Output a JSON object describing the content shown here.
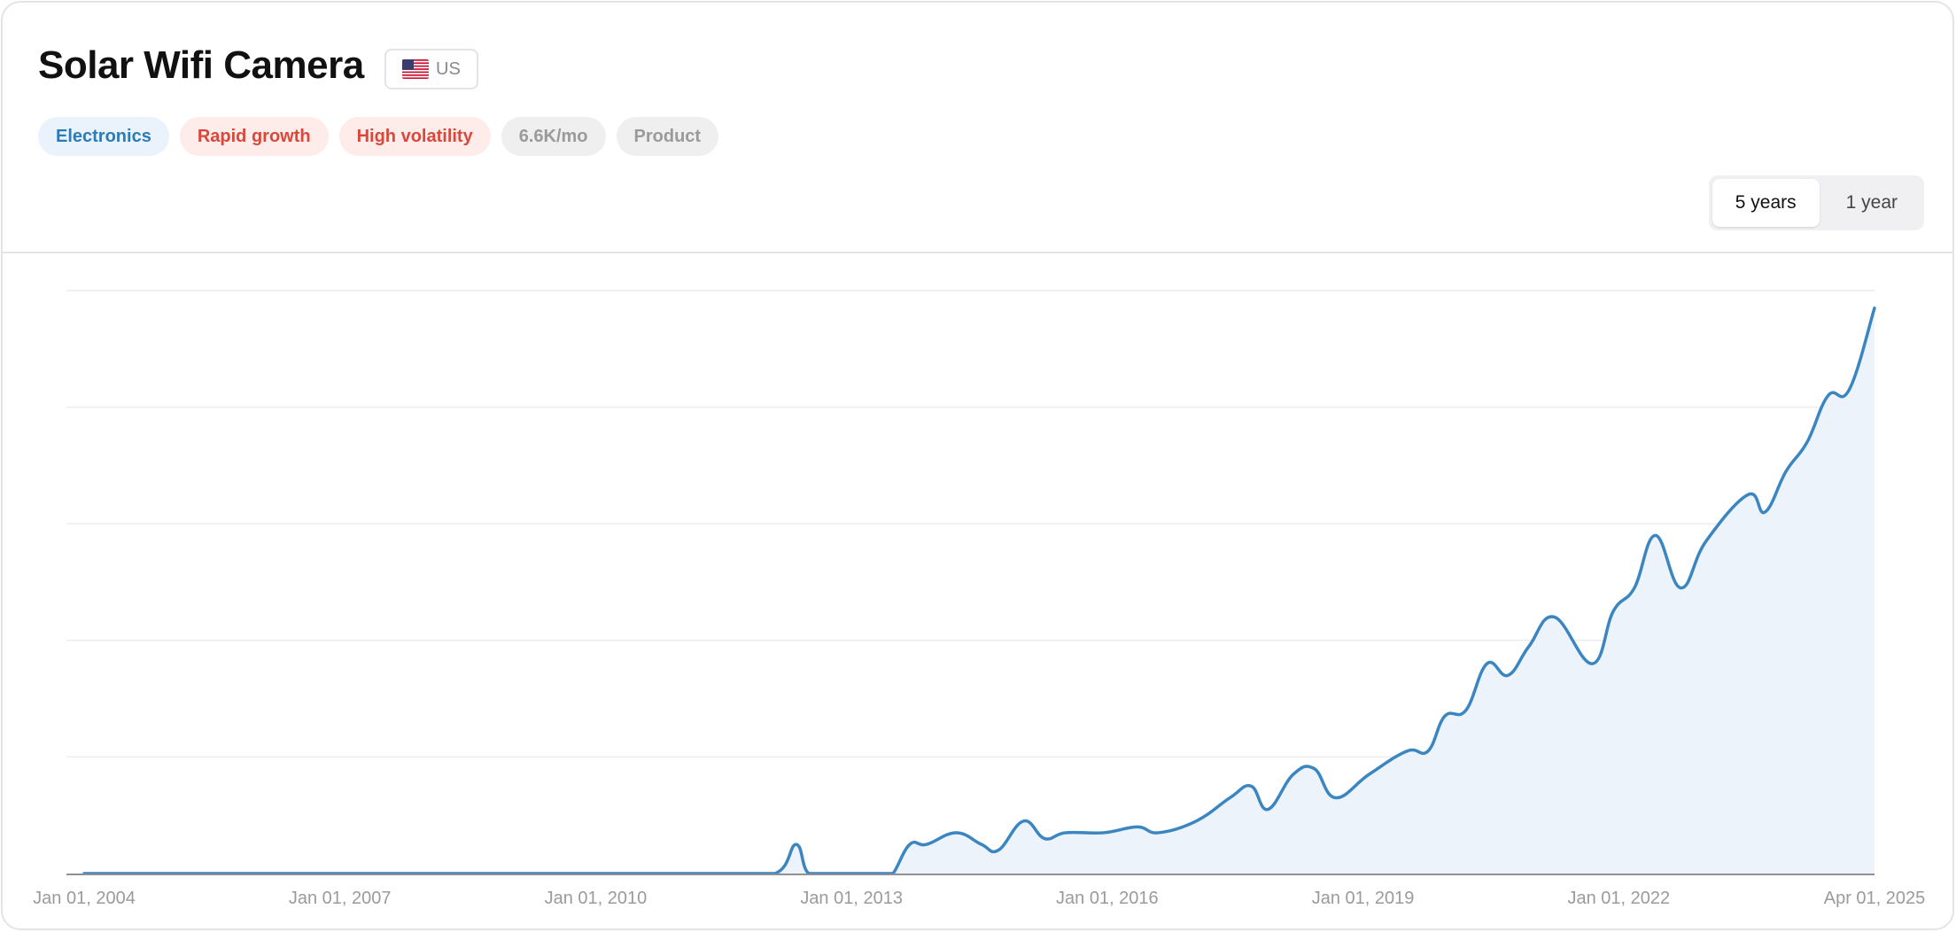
{
  "header": {
    "title": "Solar Wifi Camera",
    "region": {
      "code": "US",
      "flag_icon": "us-flag-icon"
    },
    "tags": [
      {
        "label": "Electronics",
        "style": "blue"
      },
      {
        "label": "Rapid growth",
        "style": "red"
      },
      {
        "label": "High volatility",
        "style": "red"
      },
      {
        "label": "6.6K/mo",
        "style": "gray"
      },
      {
        "label": "Product",
        "style": "gray"
      }
    ],
    "range_toggle": [
      {
        "label": "5 years",
        "active": true
      },
      {
        "label": "1 year",
        "active": false
      }
    ]
  },
  "colors": {
    "line": "#3b86c1",
    "fill": "#edf3fb",
    "grid": "#ececef",
    "axis": "#8f8f95"
  },
  "chart_data": {
    "type": "area",
    "xlabel": "",
    "ylabel": "",
    "x_ticks": [
      "Jan 01, 2004",
      "Jan 01, 2007",
      "Jan 01, 2010",
      "Jan 01, 2013",
      "Jan 01, 2016",
      "Jan 01, 2019",
      "Jan 01, 2022",
      "Apr 01, 2025"
    ],
    "x_range": [
      2004.0,
      2025.25
    ],
    "ylim": [
      0,
      100
    ],
    "grid": true,
    "points": [
      [
        2004.0,
        0
      ],
      [
        2006.0,
        0
      ],
      [
        2008.0,
        0
      ],
      [
        2010.0,
        0
      ],
      [
        2011.5,
        0
      ],
      [
        2012.2,
        0
      ],
      [
        2012.45,
        5
      ],
      [
        2012.6,
        0
      ],
      [
        2012.9,
        0
      ],
      [
        2013.5,
        0
      ],
      [
        2013.6,
        0
      ],
      [
        2013.8,
        5
      ],
      [
        2014.0,
        5
      ],
      [
        2014.35,
        7
      ],
      [
        2014.65,
        5
      ],
      [
        2014.85,
        4
      ],
      [
        2015.15,
        9
      ],
      [
        2015.4,
        6
      ],
      [
        2015.65,
        7
      ],
      [
        2016.1,
        7
      ],
      [
        2016.5,
        8
      ],
      [
        2016.75,
        7
      ],
      [
        2017.2,
        9
      ],
      [
        2017.6,
        13
      ],
      [
        2017.85,
        15
      ],
      [
        2018.05,
        11
      ],
      [
        2018.35,
        17
      ],
      [
        2018.6,
        18
      ],
      [
        2018.85,
        13
      ],
      [
        2019.25,
        17
      ],
      [
        2019.7,
        21
      ],
      [
        2019.95,
        21
      ],
      [
        2020.15,
        27
      ],
      [
        2020.4,
        28
      ],
      [
        2020.65,
        36
      ],
      [
        2020.9,
        34
      ],
      [
        2021.15,
        39
      ],
      [
        2021.45,
        44
      ],
      [
        2021.9,
        36
      ],
      [
        2022.15,
        45
      ],
      [
        2022.4,
        49
      ],
      [
        2022.65,
        58
      ],
      [
        2022.95,
        49
      ],
      [
        2023.25,
        57
      ],
      [
        2023.75,
        65
      ],
      [
        2023.95,
        62
      ],
      [
        2024.2,
        69
      ],
      [
        2024.45,
        74
      ],
      [
        2024.7,
        82
      ],
      [
        2024.95,
        83
      ],
      [
        2025.25,
        97
      ]
    ]
  }
}
